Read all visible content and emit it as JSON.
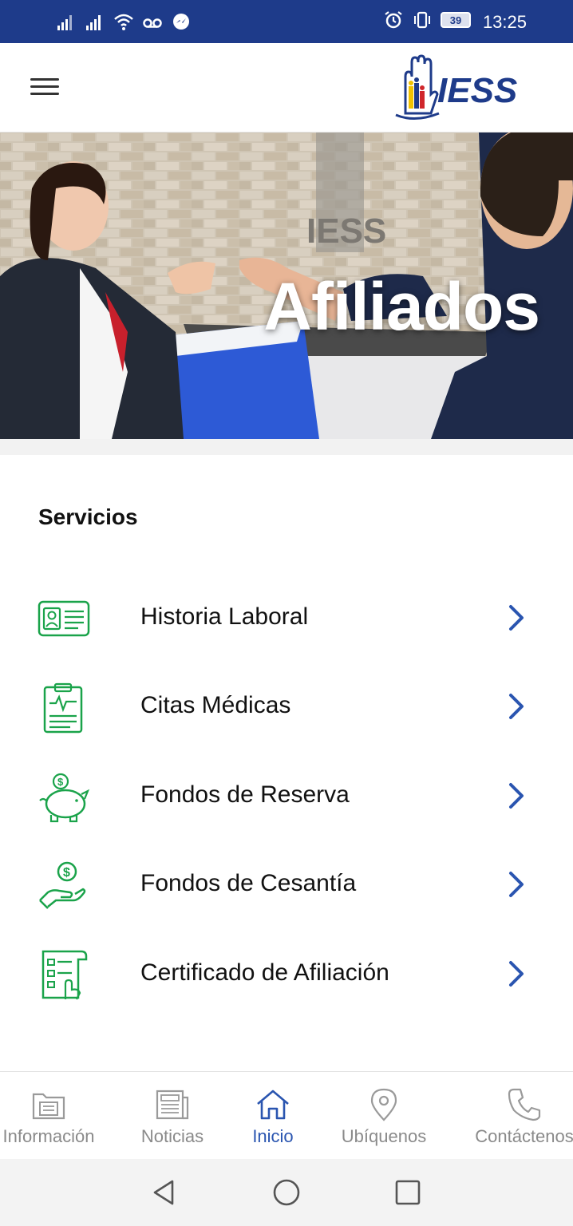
{
  "status_bar": {
    "time": "13:25",
    "battery": "39",
    "icons": [
      "signal-icon",
      "signal-icon",
      "wifi-icon",
      "voicemail-icon",
      "messenger-icon",
      "alarm-icon",
      "vibrate-icon",
      "battery-icon"
    ]
  },
  "app_bar": {
    "menu_icon": "hamburger-menu-icon",
    "logo_text": "IESS"
  },
  "hero": {
    "title": "Afiliados"
  },
  "services": {
    "title": "Servicios",
    "items": [
      {
        "label": "Historia Laboral",
        "icon": "id-card-icon"
      },
      {
        "label": "Citas Médicas",
        "icon": "medical-clipboard-icon"
      },
      {
        "label": "Fondos de Reserva",
        "icon": "piggy-bank-icon"
      },
      {
        "label": "Fondos de Cesantía",
        "icon": "hand-coin-icon"
      },
      {
        "label": "Certificado de Afiliación",
        "icon": "certificate-icon"
      }
    ],
    "icon_color": "#1aa34a",
    "chevron_color": "#2a55b0"
  },
  "bottom_nav": {
    "items": [
      {
        "label": "Información",
        "icon": "folder-icon",
        "active": false
      },
      {
        "label": "Noticias",
        "icon": "newspaper-icon",
        "active": false
      },
      {
        "label": "Inicio",
        "icon": "home-icon",
        "active": true
      },
      {
        "label": "Ubíquenos",
        "icon": "location-pin-icon",
        "active": false
      },
      {
        "label": "Contáctenos",
        "icon": "phone-icon",
        "active": false
      }
    ],
    "active_color": "#2a55b0",
    "inactive_color": "#8a8a8a"
  },
  "colors": {
    "status_bar_bg": "#1e3b8a",
    "brand_blue": "#1e3b8a"
  }
}
